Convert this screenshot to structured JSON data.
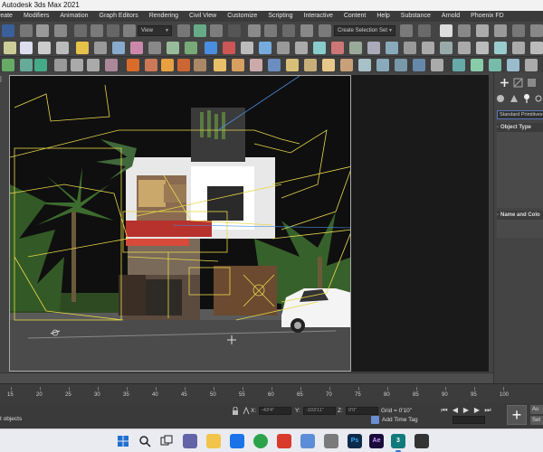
{
  "window": {
    "title": "Autodesk 3ds Max 2021"
  },
  "menu": {
    "items": [
      "reate",
      "Modifiers",
      "Animation",
      "Graph Editors",
      "Rendering",
      "Civil View",
      "Customize",
      "Scripting",
      "Interactive",
      "Content",
      "Help",
      "Substance",
      "Arnold",
      "Phoenix FD"
    ]
  },
  "toolbar": {
    "view_dropdown": "View",
    "selection_set_placeholder": "Create Selection Set"
  },
  "viewport": {
    "corner_label": "]"
  },
  "command_panel": {
    "category_dropdown": "Standard Primitives",
    "rollout_object_type": "Object Type",
    "rollout_name_color": "Name and Colo",
    "collapse_mark": "-"
  },
  "timeline": {
    "ticks": [
      "15",
      "20",
      "25",
      "30",
      "35",
      "40",
      "45",
      "50",
      "55",
      "60",
      "65",
      "70",
      "75",
      "80",
      "85",
      "90",
      "95",
      "100"
    ]
  },
  "status": {
    "message": "t objects",
    "x_label": "X:",
    "x_value": "-43'4\"",
    "y_label": "Y:",
    "y_value": "-103'11\"",
    "z_label": "Z:",
    "z_value": "0'0\"",
    "grid": "Grid = 0'10\"",
    "add_time_tag": "Add Time Tag",
    "auto_label": "Au",
    "set_label": "Set"
  },
  "taskbar": {
    "ae_label": "Ae",
    "ps_label": "Ps",
    "max_label": "3"
  },
  "colors": {
    "accent": "#6b8ed1",
    "selection_wire": "#e8d84a",
    "viewport_bg": "#101010"
  }
}
